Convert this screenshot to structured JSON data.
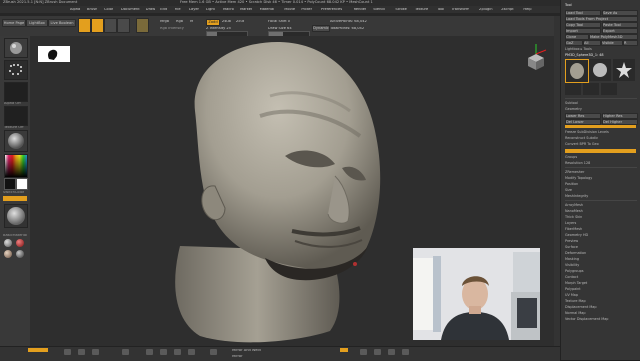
{
  "app": {
    "title": "ZBrush 2021.5.1 [N:N] ZBrush Document",
    "title_right": "Free Mem 1.6 GB • Active Mem 420 • Scratch Disk 46 • Timer 0.014 • PolyCount 68.042 KP • MeshCount 1",
    "right_links": [
      "AC",
      "QuickSave",
      "See-through 0",
      "Menus",
      "DefaultZScript"
    ]
  },
  "menu": [
    "Alpha",
    "Brush",
    "Color",
    "Document",
    "Draw",
    "Edit",
    "File",
    "Layer",
    "Light",
    "Macro",
    "Marker",
    "Material",
    "Movie",
    "Picker",
    "Preferences",
    "Render",
    "Stencil",
    "Stroke",
    "Texture",
    "Tool",
    "Transform",
    "Zplugin",
    "Zscript",
    "Help"
  ],
  "toolbar": {
    "home_page": "Home Page",
    "lightbox": "LightBox",
    "live_boolean": "Live Boolean",
    "edit_label": "Edit",
    "draw_label": "Draw",
    "move_label": "Move",
    "scale_label": "Scale",
    "rotate_label": "Rotate",
    "mrgb": "Mrgb",
    "rgb": "Rgb",
    "m": "M",
    "zadd": "Zadd",
    "zsub": "Zsub",
    "zcut": "Zcut",
    "rgb_intensity": "Rgb Intensity",
    "z_intensity": "Z Intensity 25",
    "focal_shift": "Focal Shift 0",
    "draw_size": "Draw Size 64",
    "dynamic": "Dynamic",
    "active_points": "ActivePoints: 68,042",
    "total_points": "TotalPoints: 68,042"
  },
  "left_shelf": {
    "brush_label": "ClayBuildup",
    "stroke_label": "DragRect",
    "alpha_label": "Alpha Off",
    "texture_label": "Texture Off",
    "material_label": "MatCap Gray",
    "gradient_label": "Gradient",
    "switch_color": "SwitchColor",
    "alternate": "Alternate",
    "material_swatches": [
      "BasicMaterial",
      "MatCap Red",
      "SkinShade4"
    ]
  },
  "tray": {
    "header": "Tool",
    "buttons": [
      "Load Tool",
      "Save As",
      "Load Tools From Project",
      "Copy Tool",
      "Paste Tool",
      "Import",
      "Export",
      "Clone",
      "Make PolyMesh3D",
      "GoZ",
      "All",
      "Visible",
      "R"
    ],
    "lightbox_tools": "Lightbox ▸ Tools",
    "current_tool": "PM3D_Sphere3D_1: 48",
    "sections": [
      "Subtool",
      "Geometry",
      "ArrayMesh",
      "NanoMesh",
      "Thick Skin",
      "Layers",
      "FiberMesh",
      "Geometry HD",
      "Preview",
      "Surface",
      "Deformation",
      "Masking",
      "Visibility",
      "Polygroups",
      "Contact",
      "Morph Target",
      "Polypaint",
      "UV Map",
      "Texture Map",
      "Displacement Map",
      "Normal Map",
      "Vector Displacement Map"
    ],
    "subpanel": [
      "Divide",
      "Lower Res",
      "Higher Res",
      "Del Lower",
      "Del Higher",
      "Freeze SubDivision Levels",
      "Reconstruct Subdiv",
      "Convert BPR To Geo",
      "Edge Loop",
      "Crease",
      "ShadowBox",
      "ClayPolish",
      "DynaMesh",
      "Resolution 128",
      "Groups",
      "Polish",
      "Blur 2",
      "Project",
      "ZRemesher",
      "Modify Topology",
      "Position",
      "Size",
      "MeshIntegrity"
    ]
  },
  "bottom": {
    "items": [
      "SnakeHook",
      "Move",
      "Standard",
      "ClayBuildup",
      "hPolish",
      "Pinch",
      "TrimDynamic",
      "Inflat",
      "DamStandard",
      "Move Topological",
      "Dam_Standard",
      "ZModeler",
      "Masklasso",
      "SelectRect",
      "Slash3",
      "IMM Primitives",
      "Sphere3D"
    ],
    "mirror_label": "Mirror And Weld",
    "deformer": "Mirror",
    "smooth_label": "Smooth",
    "polish_label": "Polish"
  },
  "colors": {
    "accent": "#e39f1e",
    "bg_dark": "#1e1e1e",
    "panel": "#383838",
    "viewport": "#2e2e2e",
    "sculpt": "#a39e91"
  },
  "icons": [
    "window-min-icon",
    "window-max-icon",
    "window-close-icon",
    "gizmo-icon",
    "camera-view-icon",
    "brush-icon",
    "stroke-icon"
  ]
}
